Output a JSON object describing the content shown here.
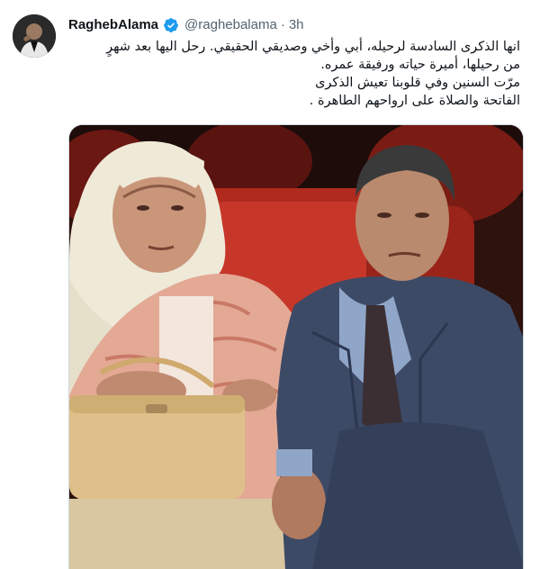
{
  "tweet": {
    "display_name": "RaghebAlama",
    "handle": "@raghebalama",
    "separator": "·",
    "time": "3h",
    "text_lines": [
      "انها الذكرى السادسة لرحيله، أبي وأخي وصديقي الحقيقي. رحل اليها بعد شهرٍ",
      "من رحيلها، أميرة حياته ورفيقة عمره.",
      "مرّت السنين وفي قلوبنا تعيش الذكرى",
      "الفاتحة والصلاة على ارواحهم الطاهرة ."
    ]
  },
  "icons": {
    "verified": "verified-badge-icon",
    "verified_color": "#1d9bf0"
  },
  "colors": {
    "name": "#0f1419",
    "secondary": "#536471",
    "border": "#cfd9de"
  }
}
